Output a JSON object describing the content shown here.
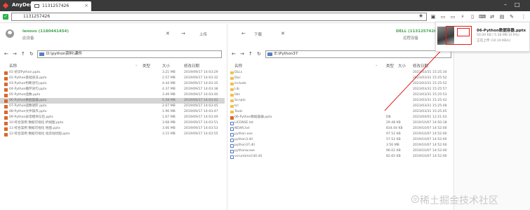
{
  "app": {
    "title": "AnyDesk",
    "tab_label": "1131257426",
    "address": "1131257426"
  },
  "icons": {
    "logo": "anydesk-logo-icon",
    "close": "close-icon",
    "star": "star-icon"
  },
  "local": {
    "name": "lenovo (1180441454)",
    "status": "此设备",
    "upload_label": "上传",
    "path": "D:\\python资料\\课件",
    "headers": {
      "name": "名称",
      "type": "类型",
      "size": "大小",
      "modified": "修改日期"
    },
    "files": [
      {
        "name": "01-初识Python.pptx",
        "size": "3.21 MB",
        "date": "2019/09/17 14:03:29"
      },
      {
        "name": "02-Python基础语法.pptx",
        "size": "2.57 MB",
        "date": "2019/09/17 14:03:32"
      },
      {
        "name": "03-Python判断语句.pptx",
        "size": "4.44 MB",
        "date": "2019/09/17 14:03:35"
      },
      {
        "name": "04-Python循环语句.pptx",
        "size": "4.37 MB",
        "date": "2019/09/17 14:03:38"
      },
      {
        "name": "05-Python函数.pptx",
        "size": "3.49 MB",
        "date": "2019/09/17 14:03:40"
      },
      {
        "name": "06-Python数据容器.pptx",
        "size": "5.58 MB",
        "date": "2019/09/17 14:03:42",
        "selected": true
      },
      {
        "name": "07-Python函数进阶.pptx",
        "size": "2.07 MB",
        "date": "2019/09/17 14:03:45"
      },
      {
        "name": "08-Python文件操作.pptx",
        "size": "1.96 MB",
        "date": "2019/09/17 14:03:47"
      },
      {
        "name": "09-Python异常模块与包.pptx",
        "size": "1.67 MB",
        "date": "2019/09/17 14:03:49"
      },
      {
        "name": "10-综合案例 数据可视化 折线图.pptx",
        "size": "3.68 MB",
        "date": "2019/09/17 14:03:51"
      },
      {
        "name": "11-综合案例 数据可视化 地图.pptx",
        "size": "3.06 MB",
        "date": "2019/09/17 14:03:53"
      },
      {
        "name": "12-综合案例 数据可视化 动态柱状图.pptx",
        "size": "3.15 MB",
        "date": "2019/09/17 14:03:55"
      }
    ]
  },
  "remote": {
    "name": "DELL (1131257426)",
    "status": "远程设备",
    "download_label": "下载",
    "path": "E:\\Python37",
    "headers": {
      "name": "名称",
      "type": "类型",
      "size": "大小",
      "modified": "修改日期"
    },
    "files": [
      {
        "name": "DLLs",
        "kind": "folder",
        "type": "",
        "size": "",
        "date": "2023/03/31 15:25:34"
      },
      {
        "name": "Doc",
        "kind": "folder",
        "type": "",
        "size": "",
        "date": "2023/03/31 15:25:52"
      },
      {
        "name": "include",
        "kind": "folder",
        "type": "",
        "size": "",
        "date": "2023/03/31 15:25:52"
      },
      {
        "name": "Lib",
        "kind": "folder",
        "type": "",
        "size": "",
        "date": "2023/03/31 15:25:57"
      },
      {
        "name": "libs",
        "kind": "folder",
        "type": "",
        "size": "",
        "date": "2023/03/31 15:25:53"
      },
      {
        "name": "Scripts",
        "kind": "folder",
        "type": "",
        "size": "",
        "date": "2023/03/31 15:25:42"
      },
      {
        "name": "tcl",
        "kind": "folder",
        "type": "",
        "size": "",
        "date": "2023/03/31 15:25:48"
      },
      {
        "name": "Tools",
        "kind": "folder",
        "type": "",
        "size": "",
        "date": "2023/03/31 15:25:45"
      },
      {
        "name": "06-Python数据容器.pptx",
        "kind": "pptx",
        "type": "DB",
        "size": "",
        "date": "2023/04/01 12:21:43"
      },
      {
        "name": "LICENSE.txt",
        "kind": "file",
        "type": "",
        "size": "29.48 KB",
        "date": "2019/10/07 14:50:18"
      },
      {
        "name": "NEWS.txt",
        "kind": "file",
        "type": "",
        "size": "834.04 KB",
        "date": "2019/10/07 14:52:00"
      },
      {
        "name": "python.exe",
        "kind": "file",
        "type": "",
        "size": "97.52 KB",
        "date": "2019/10/07 14:52:00"
      },
      {
        "name": "python3.dll",
        "kind": "file",
        "type": "",
        "size": "57.52 KB",
        "date": "2019/10/07 14:52:00"
      },
      {
        "name": "python37.dll",
        "kind": "file",
        "type": "",
        "size": "3.56 MB",
        "date": "2019/10/07 14:52:00"
      },
      {
        "name": "pythonw.exe",
        "kind": "file",
        "type": "",
        "size": "96.02 KB",
        "date": "2019/10/07 14:52:00"
      },
      {
        "name": "vcruntime140.dll",
        "kind": "file",
        "type": "",
        "size": "82.65 KB",
        "date": "2019/10/07 14:52:00"
      }
    ]
  },
  "notification": {
    "title": "06-Python数据容器.pptx",
    "progress": "50.00 KB / 5.58 MB (0.9%)",
    "status": "正在上传 (10.19 KB/s)"
  },
  "watermark": "稀土掘金技术社区",
  "colors": {
    "accent_red": "#e0201a",
    "status_green": "#2eb24b",
    "device_green": "#3fa34d"
  }
}
